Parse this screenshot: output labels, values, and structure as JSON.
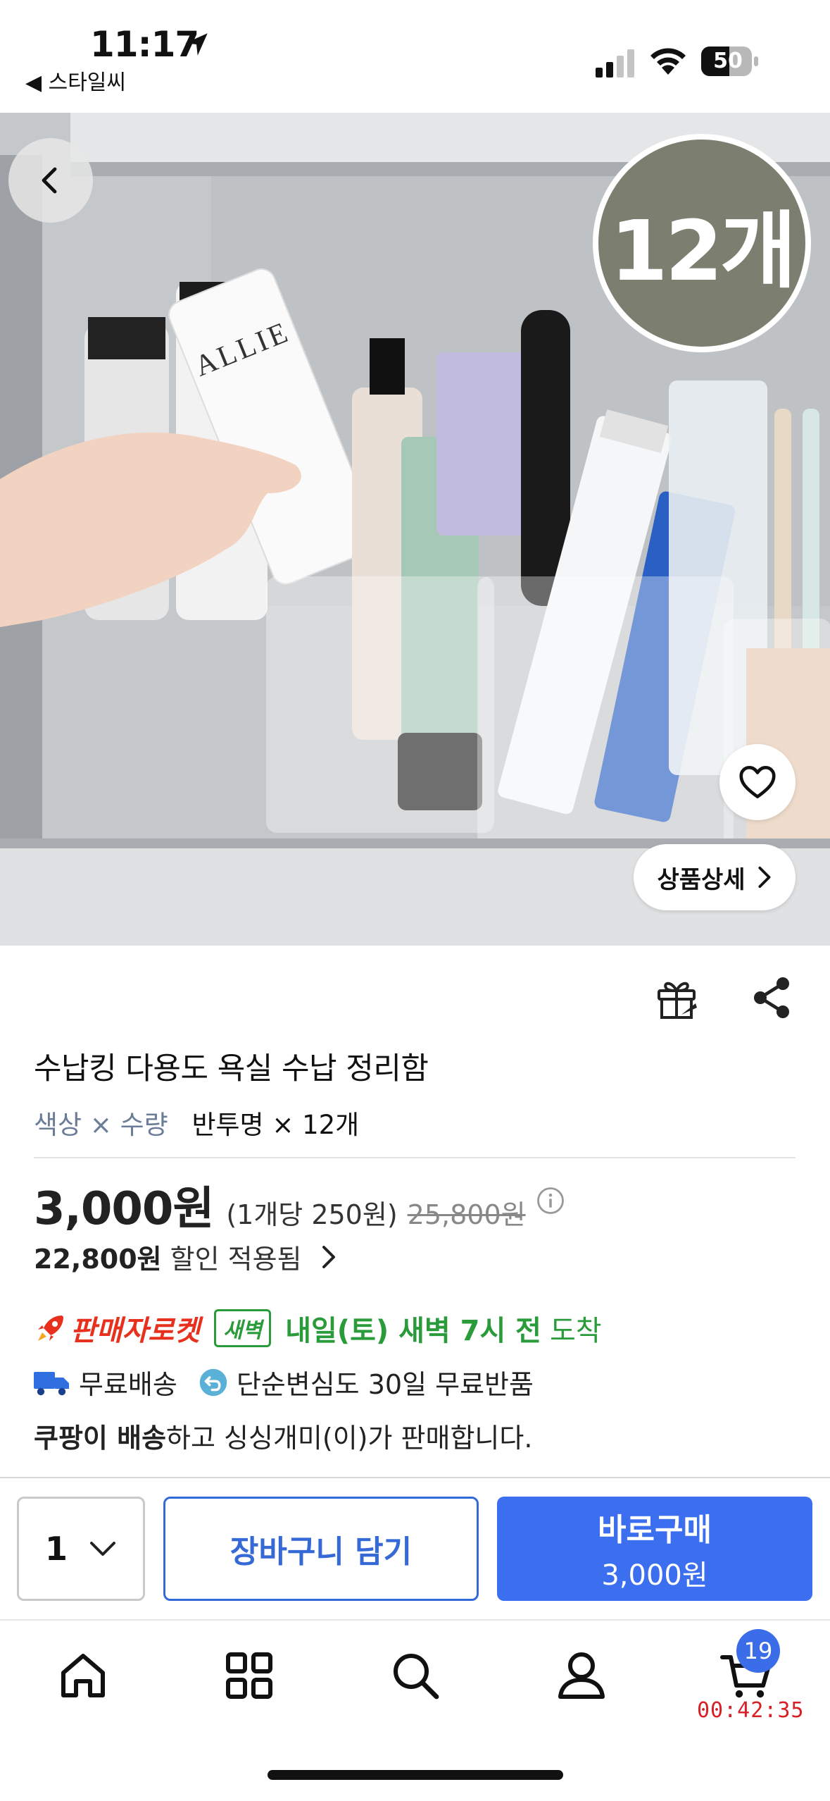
{
  "status_bar": {
    "time": "11:17",
    "back_app": "◀ 스타일씨",
    "battery": "50"
  },
  "hero": {
    "badge_text": "12개",
    "detail_button": "상품상세"
  },
  "product": {
    "title": "수납킹 다용도 욕실 수납 정리함",
    "option_label": "색상 × 수량",
    "option_value": "반투명 × 12개",
    "price": "3,000원",
    "unit_price": "(1개당 250원)",
    "original_price": "25,800원",
    "discount_amount": "22,800원",
    "discount_text": "할인 적용됨"
  },
  "delivery": {
    "rocket_label": "판매자로켓",
    "dawn_badge": "새벽",
    "arrival_bold": "내일(토) 새벽 7시 전",
    "arrival_plain": "도착",
    "free_shipping": "무료배송",
    "free_return": "단순변심도 30일 무료반품",
    "seller_bold": "쿠팡이 배송",
    "seller_text": "하고 싱싱개미(이)가 판매합니다."
  },
  "purchase_bar": {
    "quantity": "1",
    "cart_button": "장바구니 담기",
    "buy_button": "바로구매",
    "buy_price": "3,000원"
  },
  "tab_bar": {
    "cart_count": "19",
    "cart_timer": "00:42:35"
  },
  "colors": {
    "accent_blue": "#3c6ff0",
    "rocket_red": "#e7311e",
    "dawn_green": "#2a9b3a",
    "timer_red": "#d81f26"
  }
}
